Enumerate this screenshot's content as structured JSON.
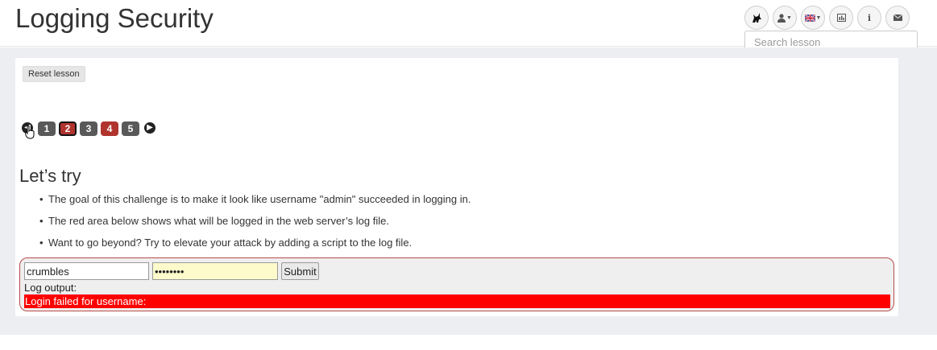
{
  "header": {
    "title": "Logging Security",
    "toolbar": [
      {
        "name": "wolf-icon",
        "glyph": "🐺"
      },
      {
        "name": "user-icon",
        "glyph": "👤",
        "caret": true
      },
      {
        "name": "uk-flag-icon",
        "glyph": "🇬🇧",
        "caret": true
      },
      {
        "name": "bar-chart-icon",
        "glyph": "📊"
      },
      {
        "name": "info-icon",
        "glyph": "i"
      },
      {
        "name": "envelope-icon",
        "glyph": "✉"
      }
    ],
    "search": {
      "placeholder": "Search lesson"
    }
  },
  "lesson": {
    "reset_label": "Reset lesson",
    "pages": [
      {
        "label": "1",
        "state": "plain"
      },
      {
        "label": "2",
        "state": "active"
      },
      {
        "label": "3",
        "state": "plain"
      },
      {
        "label": "4",
        "state": "red"
      },
      {
        "label": "5",
        "state": "plain"
      }
    ],
    "section_title": "Let’s try",
    "bullets": [
      "The goal of this challenge is to make it look like username \"admin\" succeeded in logging in.",
      "The red area below shows what will be logged in the web server’s log file.",
      "Want to go beyond? Try to elevate your attack by adding a script to the log file."
    ]
  },
  "form": {
    "username_value": "crumbles",
    "password_value": "••••••••",
    "submit_label": "Submit",
    "log_label": "Log output:",
    "log_text": "Login failed for username:"
  },
  "colors": {
    "log_background": "#ff0000",
    "page_red": "#b0332e",
    "page_gray": "#595959",
    "form_border": "#b74b4b"
  }
}
